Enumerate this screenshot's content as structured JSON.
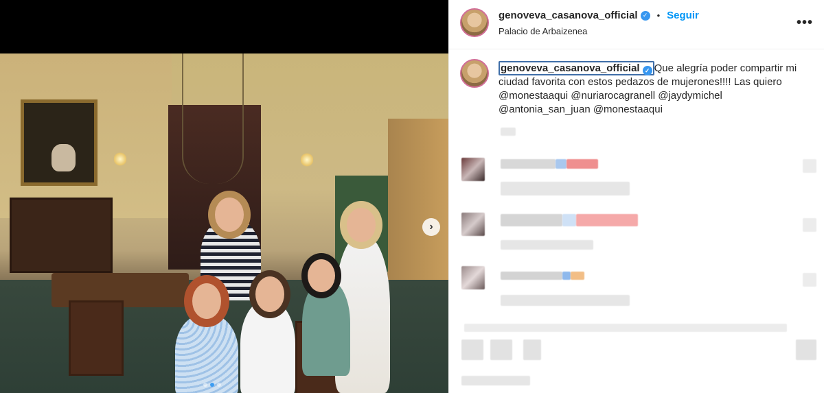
{
  "post": {
    "username": "genoveva_casanova_official",
    "verified_icon": "verified-badge-icon",
    "separator": "•",
    "follow_label": "Seguir",
    "location": "Palacio de Arbaizenea",
    "more_label": "•••",
    "caption": {
      "username": "genoveva_casanova_official",
      "text": "Que alegría poder compartir mi ciudad favorita con estos pedazos de mujerones!!!! Las quiero @monestaaqui @nuriarocagranell @jaydymichel @antonia_san_juan @monestaaqui"
    }
  },
  "carousel": {
    "next_icon": "chevron-right-icon",
    "next_label": "›",
    "dots": 3,
    "active_dot": 1
  },
  "colors": {
    "accent": "#0095f6",
    "verified": "#3897f0",
    "text": "#262626"
  }
}
